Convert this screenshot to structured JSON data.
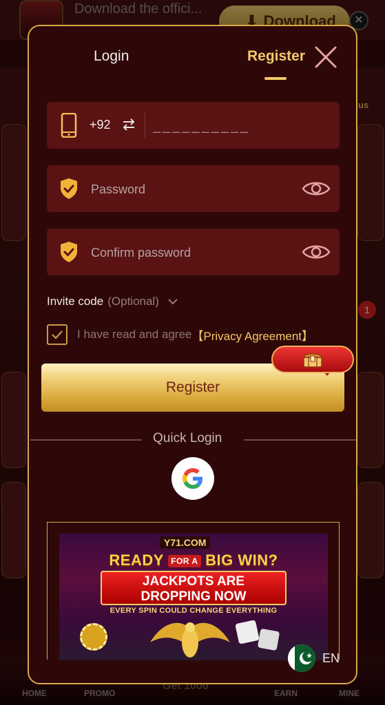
{
  "background": {
    "download_text": "Download the offici...",
    "download_button_label": "Download",
    "bonus_label": "us",
    "notification_count": "1",
    "nav": {
      "home": "HOME",
      "promo": "PROMO",
      "get": "Get 1000",
      "earn": "EARN",
      "mine": "MINE"
    }
  },
  "modal": {
    "tabs": {
      "login": "Login",
      "register": "Register",
      "active": "register"
    },
    "phone": {
      "country_code": "+92",
      "placeholder": "__________"
    },
    "password": {
      "placeholder": "Password"
    },
    "confirm_password": {
      "placeholder": "Confirm password"
    },
    "invite": {
      "label": "Invite code",
      "optional": "(Optional)"
    },
    "agreement": {
      "checked": true,
      "text": "I have read and agree",
      "link": "【Privacy Agreement】"
    },
    "register_button": "Register",
    "quick_login": {
      "title": "Quick Login",
      "provider_icon": "google-icon"
    },
    "banner": {
      "logo": "Y71.COM",
      "line1_a": "READY",
      "line1_for": "FOR A",
      "line1_b": "BIG WIN?",
      "jackpot_1": "JACKPOTS ARE",
      "jackpot_2": "DROPPING NOW",
      "subtitle": "EVERY SPIN COULD CHANGE EVERYTHING"
    },
    "language": {
      "code": "EN",
      "flag_icon": "pakistan-flag-icon"
    }
  },
  "colors": {
    "accent_gold": "#f2c96a",
    "field_bg": "#5a1213",
    "modal_bg": "#2e0808",
    "border_gold": "#d9a94a"
  }
}
